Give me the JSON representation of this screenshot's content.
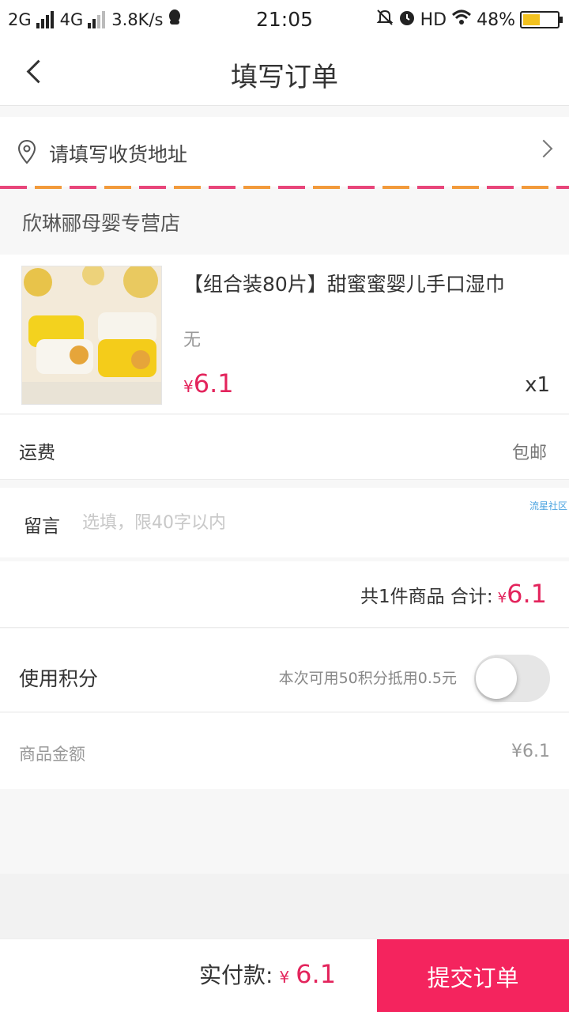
{
  "status_bar": {
    "net1": "2G",
    "net2": "4G",
    "speed": "3.8K/s",
    "time": "21:05",
    "hd": "HD",
    "battery": "48%"
  },
  "header": {
    "title": "填写订单"
  },
  "address": {
    "placeholder": "请填写收货地址"
  },
  "store": {
    "name": "欣琳郦母婴专营店"
  },
  "product": {
    "title": "【组合装80片】甜蜜蜜婴儿手口湿巾",
    "spec": "无",
    "currency": "¥",
    "price": "6.1",
    "quantity": "x1"
  },
  "shipping": {
    "label": "运费",
    "value": "包邮"
  },
  "message": {
    "label": "留言",
    "placeholder": "选填，限40字以内",
    "watermark": "流星社区"
  },
  "summary": {
    "text": "共1件商品  合计:",
    "currency": "¥",
    "price": "6.1"
  },
  "points": {
    "label": "使用积分",
    "desc": "本次可用50积分抵用0.5元",
    "enabled": false
  },
  "goods_amount": {
    "label": "商品金额",
    "value": "¥6.1"
  },
  "bottom_bar": {
    "pay_label": "实付款:",
    "currency": "¥",
    "price": "6.1",
    "submit_label": "提交订单"
  },
  "colors": {
    "accent": "#e3245c",
    "submit_bg": "#f4245e"
  }
}
